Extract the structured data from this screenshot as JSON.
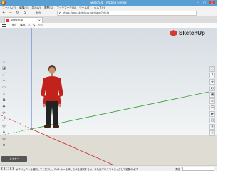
{
  "window": {
    "title": "SketchUp - Mozilla Firefox",
    "min": "–",
    "max": "□",
    "close": "✕"
  },
  "menu": [
    "ファイル(F)",
    "編集(E)",
    "表示(V)",
    "履歴(S)",
    "ブックマーク(B)",
    "ツール(T)",
    "ヘルプ(H)"
  ],
  "nav": {
    "back": "←",
    "forward": "→",
    "reload": "↻",
    "home": "⌂",
    "zoom": "90%",
    "url": "https://app.sketchup.com/app?hl=ja"
  },
  "tab": {
    "label": "SketchUp",
    "close": "×",
    "newtab": "+"
  },
  "apptoolbar": {
    "open": "開く",
    "save": "保存",
    "undo": "↶",
    "redo": "↷",
    "modelname": "無題"
  },
  "brand": {
    "logo_text": "SketchUp",
    "accent": "#d83a2f"
  },
  "axes": {
    "red": "#c62828",
    "green": "#2e9d2e",
    "blue": "#2b4bd6"
  },
  "tools_left": [
    {
      "icon": "select-icon",
      "glyph": "↖"
    },
    {
      "icon": "eraser-icon",
      "glyph": "◪"
    },
    {
      "icon": "line-icon",
      "glyph": "／"
    },
    {
      "icon": "arc-icon",
      "glyph": "◠"
    },
    {
      "icon": "rectangle-icon",
      "glyph": "▭"
    },
    {
      "icon": "push-pull-icon",
      "glyph": "⇳"
    },
    {
      "icon": "offset-icon",
      "glyph": "⧉"
    },
    {
      "icon": "move-icon",
      "glyph": "✥"
    },
    {
      "icon": "rotate-icon",
      "glyph": "⟳"
    },
    {
      "icon": "scale-icon",
      "glyph": "⤢"
    },
    {
      "icon": "tape-measure-icon",
      "glyph": "◎"
    },
    {
      "icon": "text-icon",
      "glyph": "A"
    },
    {
      "icon": "paint-bucket-icon",
      "glyph": "◍"
    },
    {
      "icon": "orbit-icon",
      "glyph": "⊚"
    }
  ],
  "tools_right": [
    {
      "icon": "entity-info-icon",
      "glyph": "ⓘ"
    },
    {
      "icon": "instructor-icon",
      "glyph": "?"
    },
    {
      "icon": "components-icon",
      "glyph": "❖"
    },
    {
      "icon": "materials-icon",
      "glyph": "◐"
    },
    {
      "icon": "styles-icon",
      "glyph": "▣"
    },
    {
      "icon": "layers-icon",
      "glyph": "≡"
    },
    {
      "icon": "outliner-icon",
      "glyph": "☰"
    },
    {
      "icon": "scenes-icon",
      "glyph": "▶"
    },
    {
      "icon": "display-icon",
      "glyph": "◫"
    },
    {
      "icon": "shadows-icon",
      "glyph": "☀"
    },
    {
      "icon": "solar-icon",
      "glyph": "☼"
    }
  ],
  "panel_button": "レイヤー",
  "status": {
    "text": "オブジェクトを選択してください。Shift キーを押しながら選択するか、またはマウスでドラッグして複数のオブ",
    "measurements_label": "測定"
  }
}
